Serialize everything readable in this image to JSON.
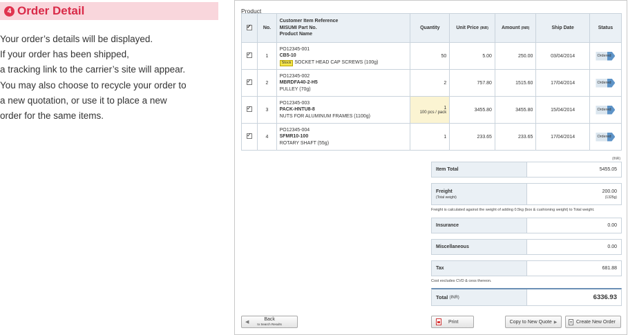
{
  "left_panel": {
    "step_number": "4",
    "title": "Order Detail",
    "description_lines": [
      "Your order’s details will be displayed.",
      "If your order has been shipped,",
      "a tracking link to the carrier’s site will appear.",
      "You may also choose to recycle your order to",
      "a new quotation, or use it to place a new",
      "order for the same items."
    ]
  },
  "product_section": {
    "label": "Product",
    "headers": {
      "no": "No.",
      "ref_line1": "Customer Item Reference",
      "ref_line2": "MISUMI Part No.",
      "ref_line3": "Product Name",
      "quantity": "Quantity",
      "unit_price": "Unit Price",
      "unit_price_unit": "(INR)",
      "amount": "Amount",
      "amount_unit": "(INR)",
      "ship_date": "Ship Date",
      "status": "Status"
    },
    "rows": [
      {
        "no": "1",
        "customer_ref": "PO12345-001",
        "part_no": "CB5-10",
        "stock_badge": "Stock",
        "product_name": "SOCKET HEAD CAP SCREWS (100g)",
        "quantity": "50",
        "qty_note": "",
        "unit_price": "5.00",
        "amount": "250.00",
        "ship_date": "03/04/2014",
        "status": "Ordered"
      },
      {
        "no": "2",
        "customer_ref": "PO12345-002",
        "part_no": "MBRDFA40-2-H5",
        "stock_badge": "",
        "product_name": "PULLEY (70g)",
        "quantity": "2",
        "qty_note": "",
        "unit_price": "757.80",
        "amount": "1515.60",
        "ship_date": "17/04/2014",
        "status": "Ordered"
      },
      {
        "no": "3",
        "customer_ref": "PO12345-003",
        "part_no": "PACK-HNTU8-8",
        "stock_badge": "",
        "product_name": "NUTS FOR ALUMINUM FRAMES (1100g)",
        "quantity": "1",
        "qty_note": "100 pcs / pack",
        "unit_price": "3455.80",
        "amount": "3455.80",
        "ship_date": "15/04/2014",
        "status": "Ordered"
      },
      {
        "no": "4",
        "customer_ref": "PO12345-004",
        "part_no": "SFMR10-100",
        "stock_badge": "",
        "product_name": "ROTARY SHAFT (55g)",
        "quantity": "1",
        "qty_note": "",
        "unit_price": "233.65",
        "amount": "233.65",
        "ship_date": "17/04/2014",
        "status": "Ordered"
      }
    ]
  },
  "totals": {
    "currency_note": "(INR)",
    "item_total_label": "Item Total",
    "item_total_value": "5455.05",
    "freight_label": "Freight",
    "freight_sub_label": "(Total weight)",
    "freight_value": "200.00",
    "freight_weight": "(1325g)",
    "freight_note": "Freight is calculated against the weight of adding 0.5kg (box & cushioning weight) to Total weight.",
    "insurance_label": "Insurance",
    "insurance_value": "0.00",
    "misc_label": "Miscellaneous",
    "misc_value": "0.00",
    "tax_label": "Tax",
    "tax_value": "681.88",
    "tax_note": "Cost excludes CVD & cess thereon.",
    "total_label": "Total",
    "total_unit": "(INR)",
    "total_value": "6336.93"
  },
  "buttons": {
    "back": "Back",
    "back_sub": "to Search Results",
    "print": "Print",
    "copy_quote": "Copy to New Quote",
    "create_order": "Create New Order"
  },
  "colors": {
    "title": "#d92a48",
    "title_bg": "#f9d6dc",
    "header_bg": "#eaf0f5"
  }
}
